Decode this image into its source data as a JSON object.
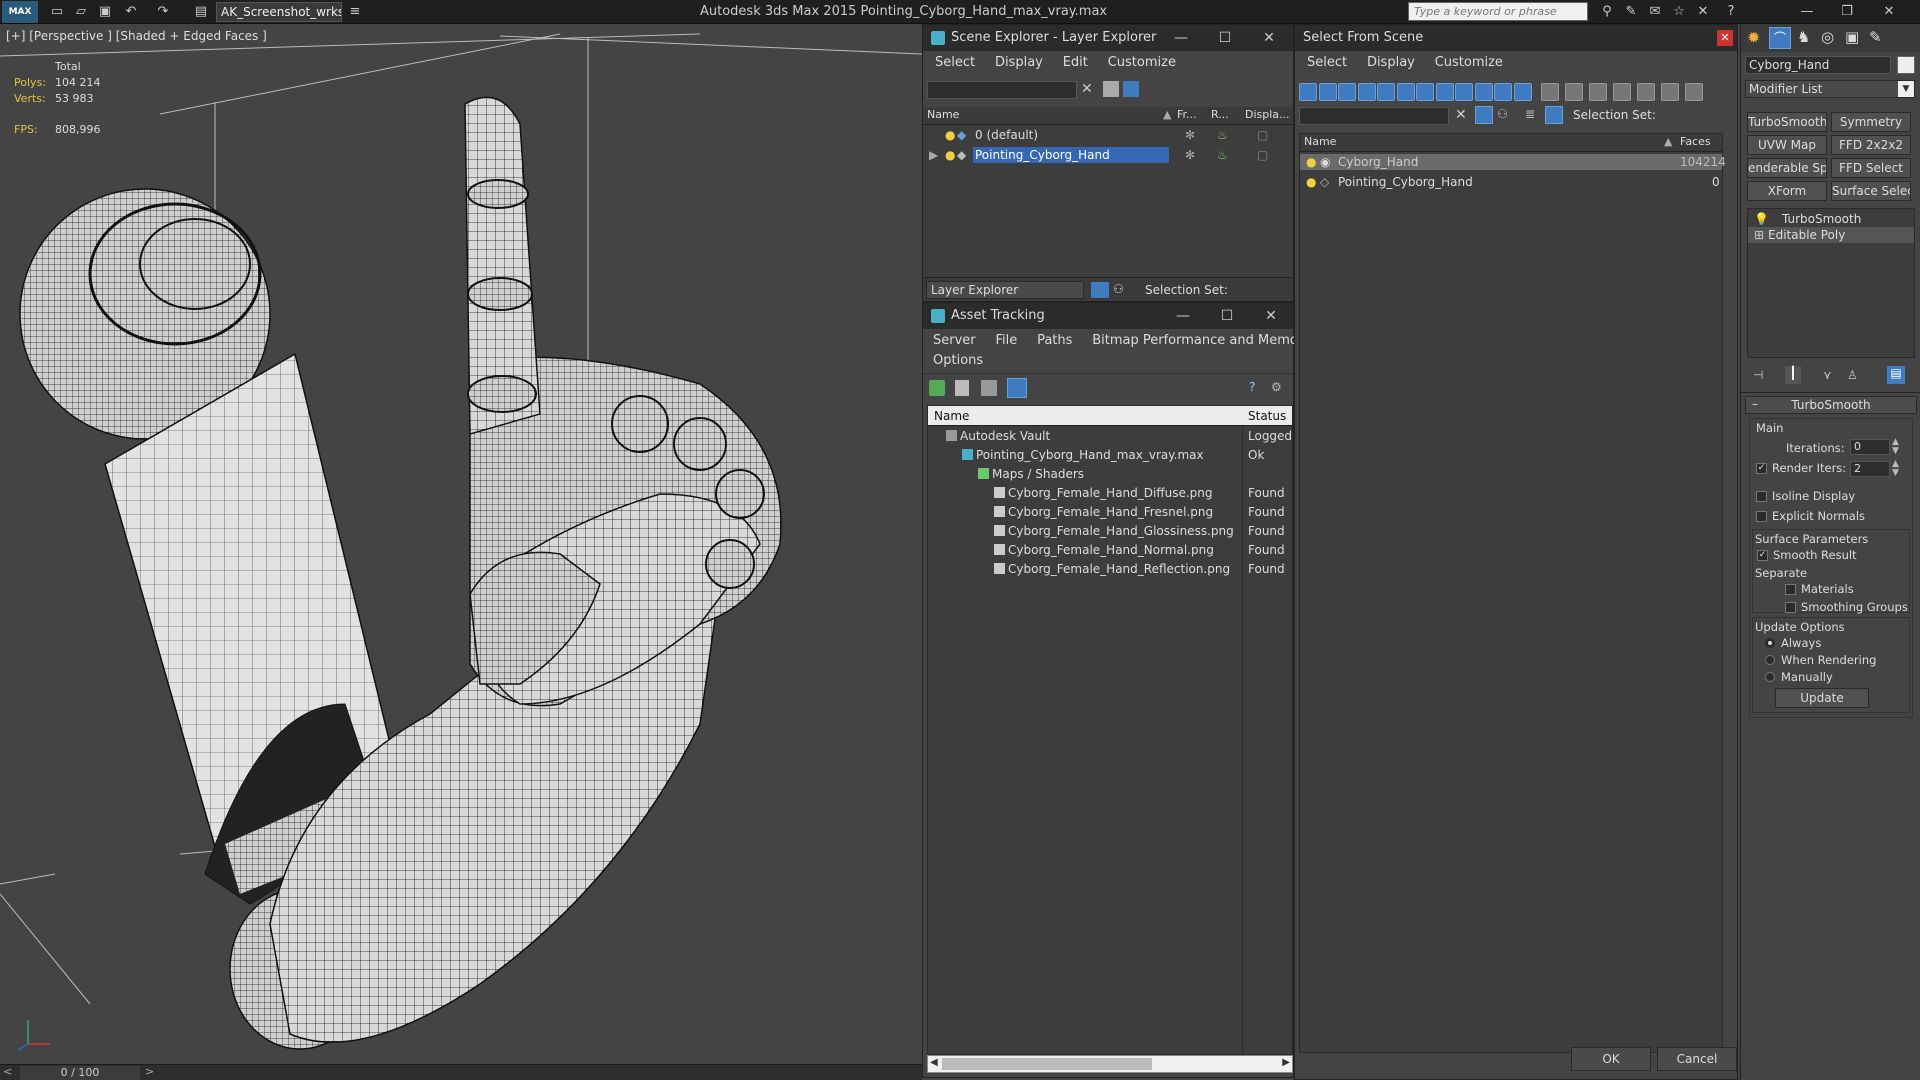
{
  "app": {
    "logo": "MAX",
    "workspace": "AK_Screenshot_wrksp",
    "title": "Autodesk 3ds Max  2015     Pointing_Cyborg_Hand_max_vray.max",
    "search_placeholder": "Type a keyword or phrase"
  },
  "viewport": {
    "label": "[+] [Perspective ] [Shaded + Edged Faces ]",
    "stats": {
      "total_label": "Total",
      "polys_label": "Polys:",
      "polys_value": "104 214",
      "verts_label": "Verts:",
      "verts_value": "53 983",
      "fps_label": "FPS:",
      "fps_value": "808,996"
    },
    "timeline": "0 / 100"
  },
  "scene_explorer": {
    "title": "Scene Explorer - Layer Explorer",
    "menu": [
      "Select",
      "Display",
      "Edit",
      "Customize"
    ],
    "columns": [
      "Name",
      "Fr...",
      "R...",
      "Displa..."
    ],
    "rows": [
      "0 (default)",
      "Pointing_Cyborg_Hand"
    ],
    "footer_dropdown": "Layer Explorer",
    "selection_set_label": "Selection Set:"
  },
  "asset_tracking": {
    "title": "Asset Tracking",
    "menu": [
      "Server",
      "File",
      "Paths",
      "Bitmap Performance and Memory"
    ],
    "menu2": "Options",
    "columns": [
      "Name",
      "Status"
    ],
    "rows": [
      {
        "name": "Autodesk Vault",
        "status": "Logged"
      },
      {
        "name": "Pointing_Cyborg_Hand_max_vray.max",
        "status": "Ok"
      },
      {
        "name": "Maps / Shaders",
        "status": ""
      },
      {
        "name": "Cyborg_Female_Hand_Diffuse.png",
        "status": "Found"
      },
      {
        "name": "Cyborg_Female_Hand_Fresnel.png",
        "status": "Found"
      },
      {
        "name": "Cyborg_Female_Hand_Glossiness.png",
        "status": "Found"
      },
      {
        "name": "Cyborg_Female_Hand_Normal.png",
        "status": "Found"
      },
      {
        "name": "Cyborg_Female_Hand_Reflection.png",
        "status": "Found"
      }
    ]
  },
  "select_from_scene": {
    "title": "Select From Scene",
    "menu": [
      "Select",
      "Display",
      "Customize"
    ],
    "selection_set_label": "Selection Set:",
    "columns": [
      "Name",
      "Faces"
    ],
    "rows": [
      {
        "name": "Cyborg_Hand",
        "faces": "104214"
      },
      {
        "name": "Pointing_Cyborg_Hand",
        "faces": "0"
      }
    ],
    "ok": "OK",
    "cancel": "Cancel"
  },
  "command_panel": {
    "object_name": "Cyborg_Hand",
    "modifier_list": "Modifier List",
    "buttons": [
      "TurboSmooth",
      "Symmetry",
      "UVW Map",
      "FFD 2x2x2",
      "enderable Spli",
      "FFD Select",
      "XForm",
      "Surface Select"
    ],
    "stack": [
      "TurboSmooth",
      "Editable Poly"
    ],
    "rollout_title": "TurboSmooth",
    "main_label": "Main",
    "iterations_label": "Iterations:",
    "iterations_value": "0",
    "render_iters_label": "Render Iters:",
    "render_iters_value": "2",
    "isoline": "Isoline Display",
    "explicit_normals": "Explicit Normals",
    "surface_params": "Surface Parameters",
    "smooth_result": "Smooth Result",
    "separate": "Separate",
    "materials": "Materials",
    "smoothing_groups": "Smoothing Groups",
    "update_options": "Update Options",
    "always": "Always",
    "when_rendering": "When Rendering",
    "manually": "Manually",
    "update": "Update"
  }
}
